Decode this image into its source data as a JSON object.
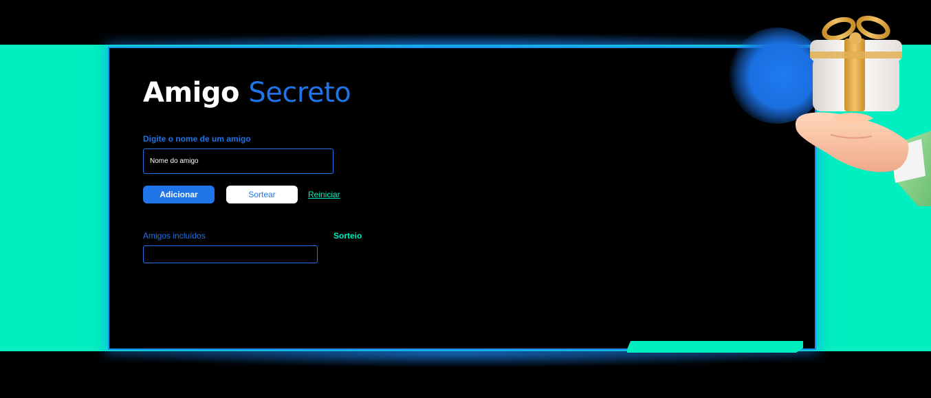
{
  "header": {
    "title_main": "Amigo",
    "title_accent": "Secreto"
  },
  "form": {
    "field_label": "Digite o nome de um amigo",
    "input_placeholder": "Nome do amigo",
    "input_value": ""
  },
  "actions": {
    "add_label": "Adicionar",
    "draw_label": "Sortear",
    "reset_label": "Reiniciar"
  },
  "lists": {
    "friends_label": "Amigos incluídos",
    "result_label": "Sorteio"
  },
  "illustration": {
    "icon": "gift-in-hand-icon"
  },
  "colors": {
    "background": "#000000",
    "band": "#00EFC1",
    "accent_blue": "#1F74E8",
    "accent_green": "#00EFC1"
  }
}
